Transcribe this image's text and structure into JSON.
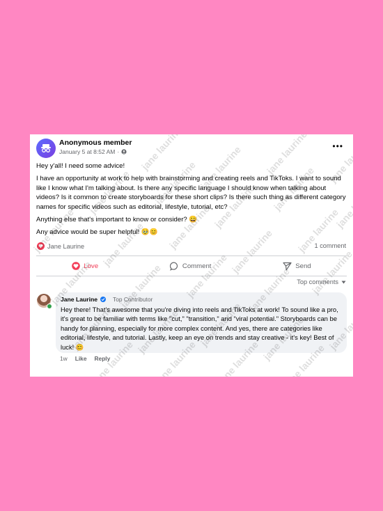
{
  "post": {
    "author": "Anonymous member",
    "date": "January 5 at 8:52 AM",
    "separator": "·",
    "paragraphs": [
      "Hey y'all! I need some advice!",
      "I have an opportunity at work to help with brainstorming and creating reels and TikToks. I want to sound like I know what I'm talking about. Is there any specific language I should know when talking about videos? Is it common to create storyboards for these short clips? Is there such thing as different category names for specific videos such as editorial, lifestyle, tutorial, etc?",
      "Anything else that's important to know or consider? 😀",
      "Any advice would be super helpful! 🥹😊"
    ],
    "reaction_name": "Jane Laurine",
    "comment_count": "1 comment"
  },
  "actions": {
    "love": "Love",
    "comment": "Comment",
    "send": "Send"
  },
  "comments_filter": "Top comments",
  "comment": {
    "author": "Jane Laurine",
    "badge": "Top Contributor",
    "text": "Hey there! That's awesome that you're diving into reels and TikToks at work! To sound like a pro, it's great to be familiar with terms like \"cut,\" \"transition,\" and \"viral potential.\" Storyboards can be handy for planning, especially for more complex content. And yes, there are categories like editorial, lifestyle, and tutorial. Lastly, keep an eye on trends and stay creative - it's key! Best of luck! 😊",
    "time": "1w",
    "like": "Like",
    "reply": "Reply"
  },
  "watermark_text": "jane laurine",
  "colors": {
    "background": "#ff87c2",
    "love": "#f33e58",
    "verified": "#1877f2",
    "bubble": "#f0f2f5"
  }
}
